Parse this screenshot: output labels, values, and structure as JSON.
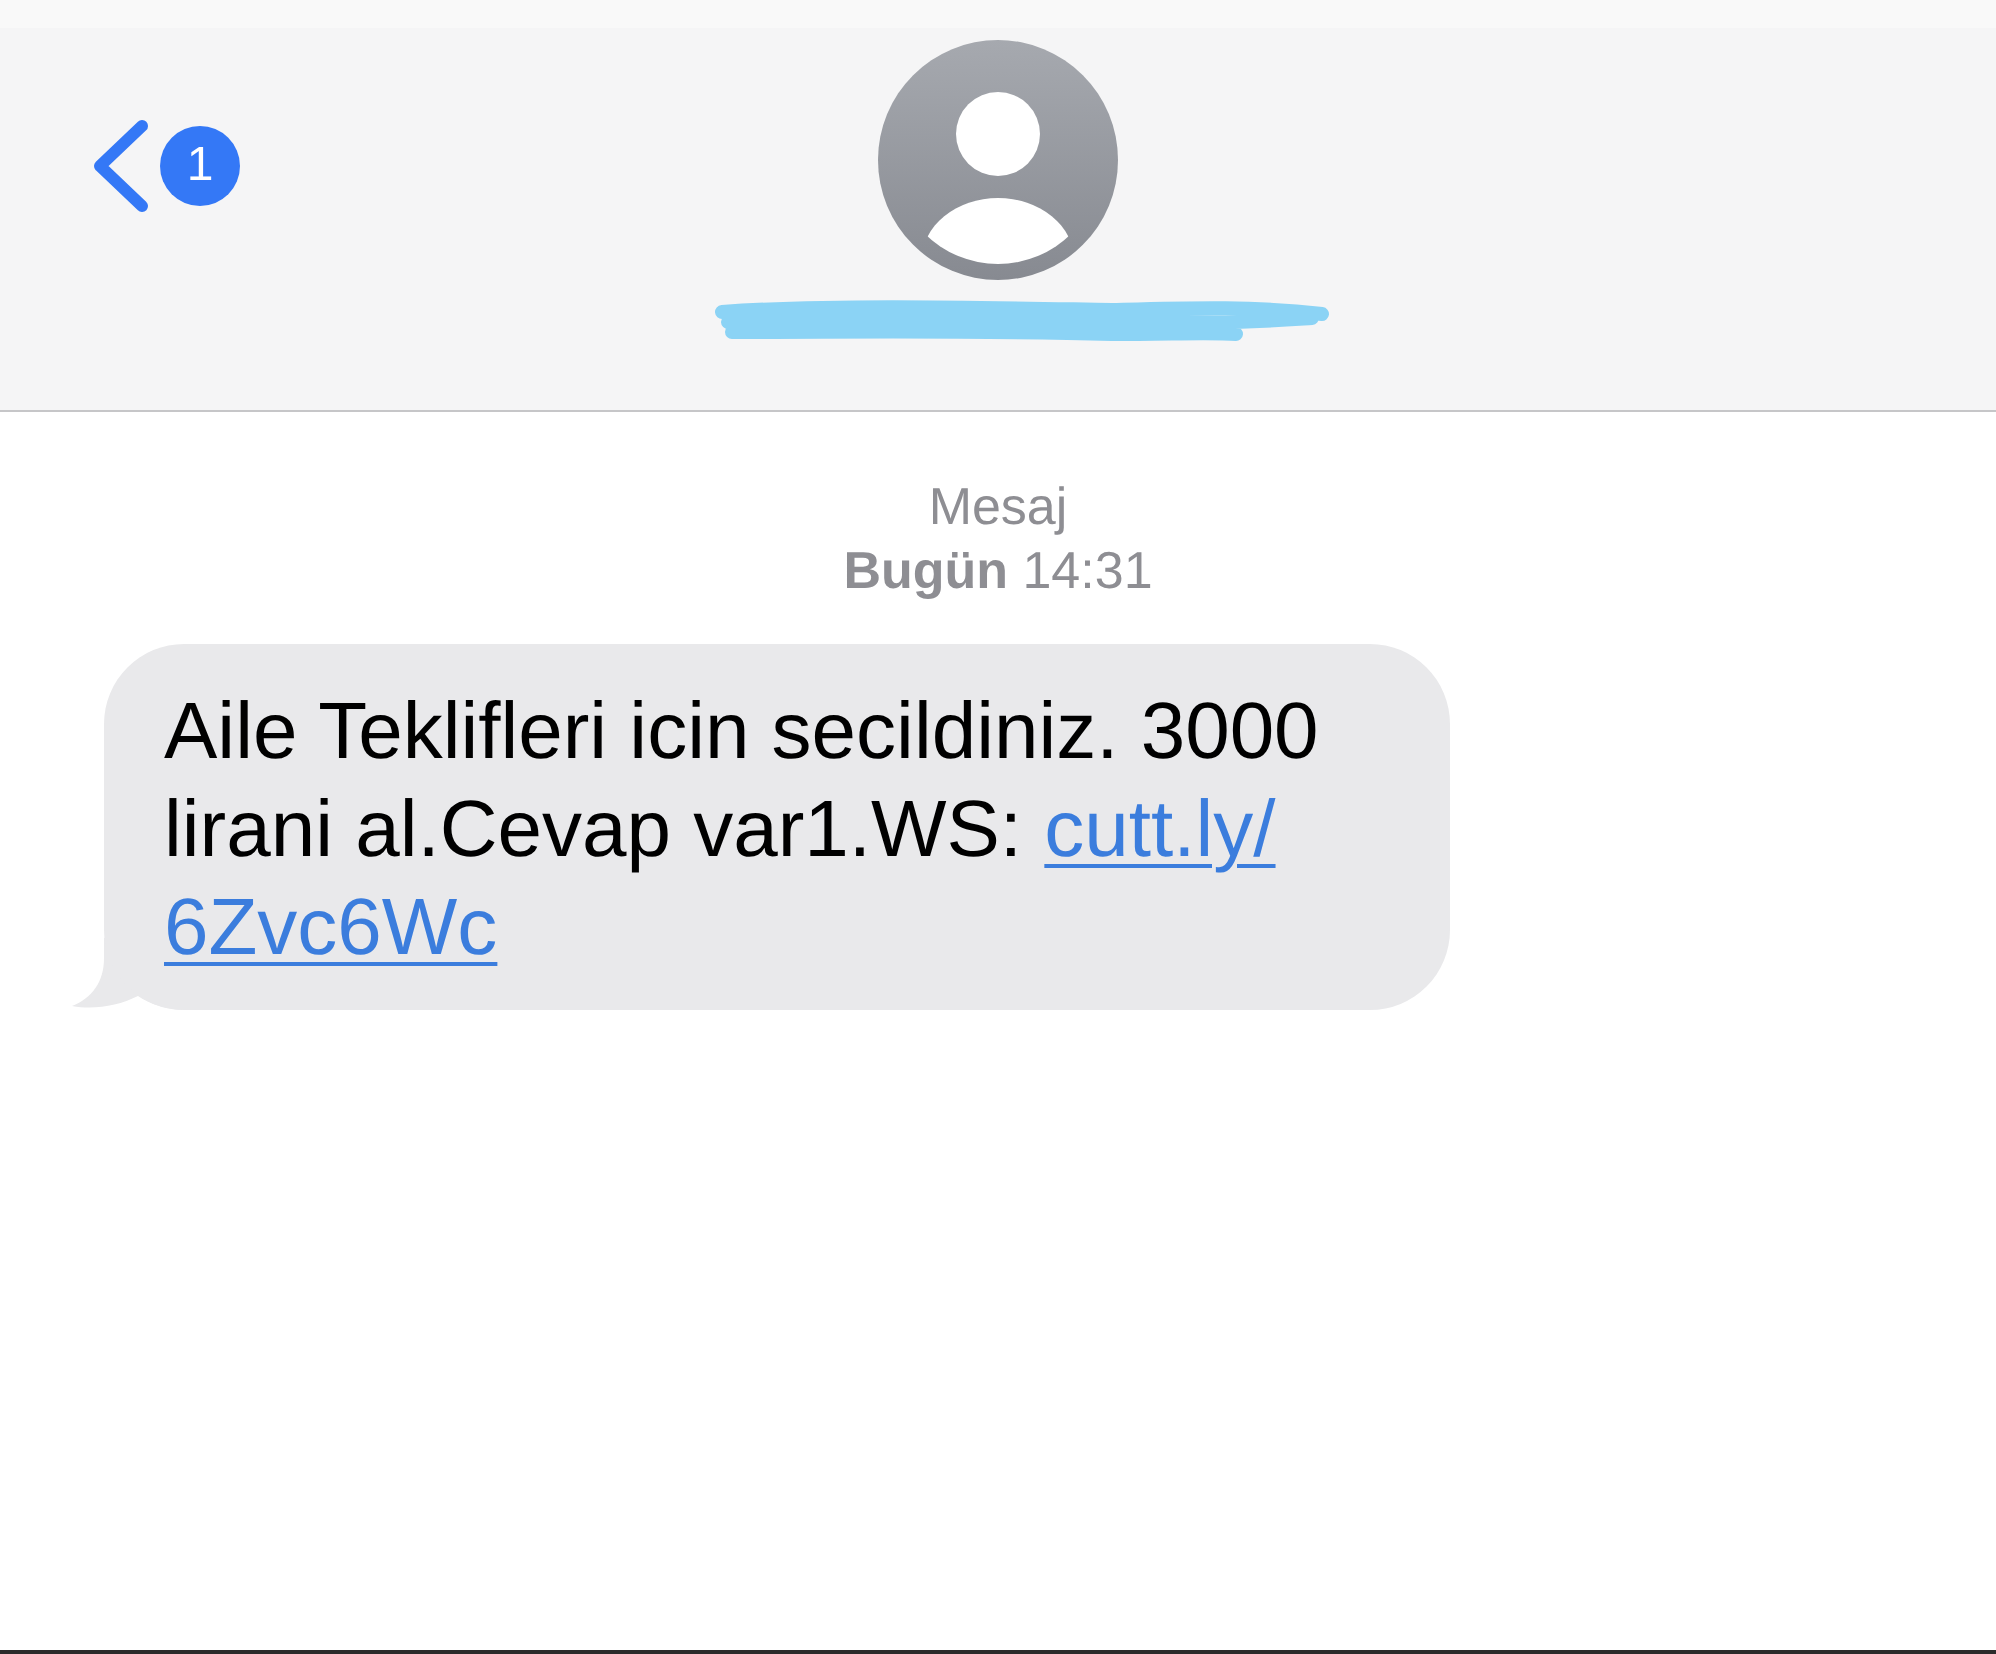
{
  "header": {
    "back_button": {
      "badge": "1"
    },
    "contact": {
      "name_redacted": true
    }
  },
  "thread": {
    "service_label": "Mesaj",
    "timestamp": "**Bugün** 14:31",
    "messages": [
      {
        "kind": "incoming",
        "text": "Aile Teklifleri icin secildiniz. 3000 lirani al.Cevap var1.WS:",
        "link_lines": [
          "cutt.ly/",
          "6Zvc6Wc"
        ]
      }
    ]
  }
}
